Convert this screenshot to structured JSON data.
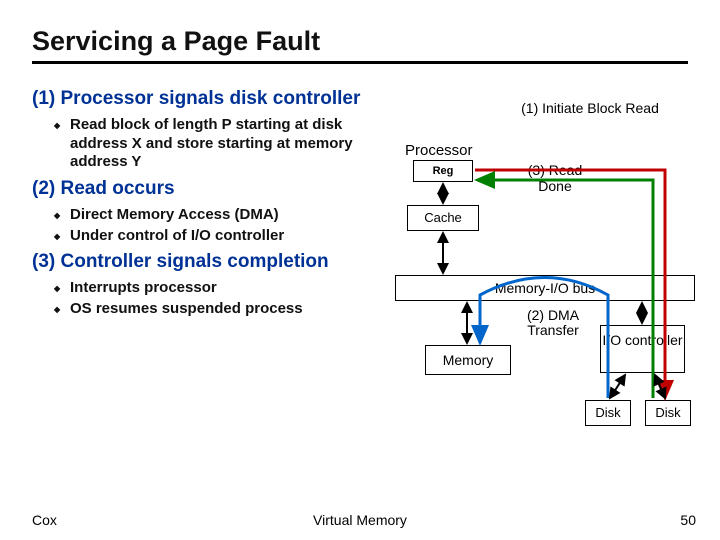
{
  "title": "Servicing a Page Fault",
  "steps": [
    {
      "heading": "(1) Processor signals disk controller",
      "bullets": [
        "Read block of length P starting at disk address X and store starting at memory address Y"
      ]
    },
    {
      "heading": "(2) Read occurs",
      "bullets": [
        "Direct Memory Access (DMA)",
        "Under control of I/O controller"
      ]
    },
    {
      "heading": "(3) Controller signals completion",
      "bullets": [
        "Interrupts processor",
        "OS resumes suspended process"
      ]
    }
  ],
  "diagram": {
    "processor": "Processor",
    "reg": "Reg",
    "cache": "Cache",
    "bus": "Memory-I/O bus",
    "memory": "Memory",
    "io_controller": "I/O controller",
    "disk": "Disk",
    "lbl_init": "(1) Initiate Block Read",
    "lbl_dma": "(2) DMA Transfer",
    "lbl_done": "(3) Read Done"
  },
  "footer": {
    "left": "Cox",
    "center": "Virtual Memory",
    "right": "50"
  }
}
